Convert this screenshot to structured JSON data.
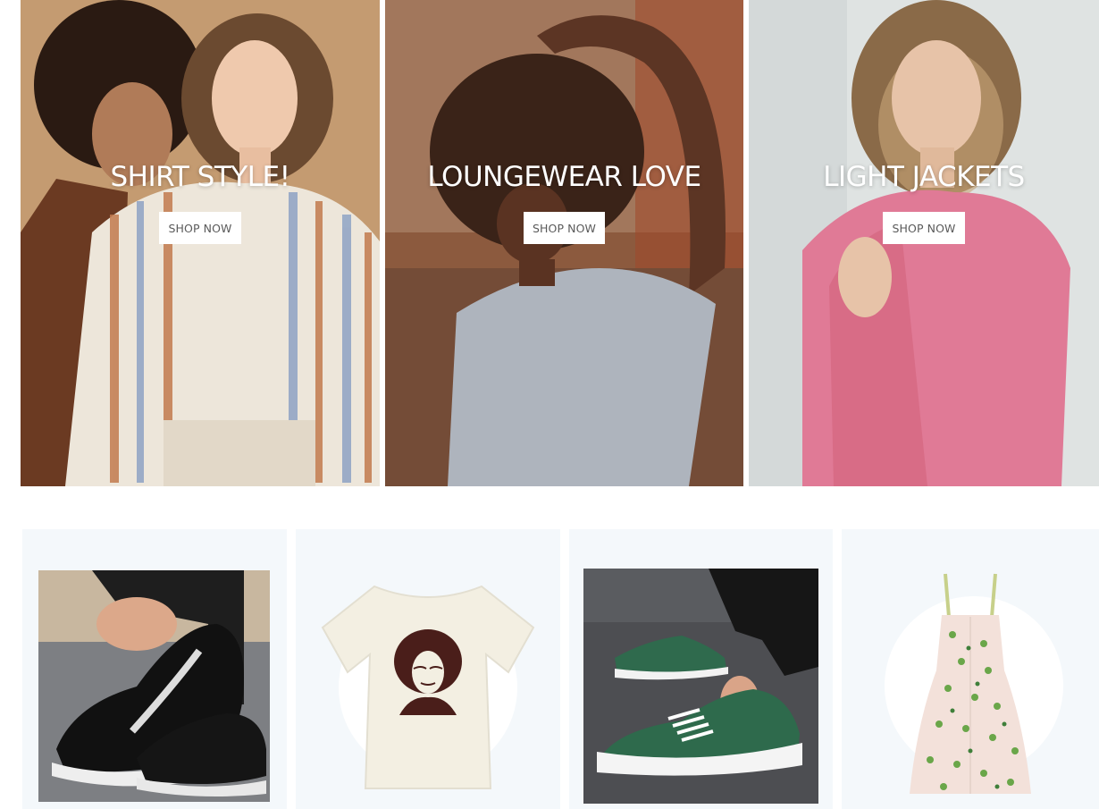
{
  "banners": [
    {
      "title": "SHIRT STYLE!",
      "button": "SHOP NOW",
      "image": "two-women-striped-shirt-photo"
    },
    {
      "title": "LOUNGEWEAR LOVE",
      "button": "SHOP NOW",
      "image": "woman-grey-tshirt-photo"
    },
    {
      "title": "LIGHT JACKETS",
      "button": "SHOP NOW",
      "image": "woman-pink-jacket-photo"
    }
  ],
  "products": [
    {
      "image": "black-white-sneakers-photo"
    },
    {
      "image": "cream-graphic-tshirt-photo"
    },
    {
      "image": "green-canvas-sneakers-photo"
    },
    {
      "image": "floral-sundress-photo"
    }
  ],
  "colors": {
    "button_bg": "#ffffff",
    "button_text": "#5a5a5a",
    "card_bg": "#f4f8fb",
    "banner1_bg": "#c9a57c",
    "banner2_bg": "#8c5a3e",
    "banner3_bg": "#dfe3e2",
    "jacket_pink": "#e07a96"
  }
}
